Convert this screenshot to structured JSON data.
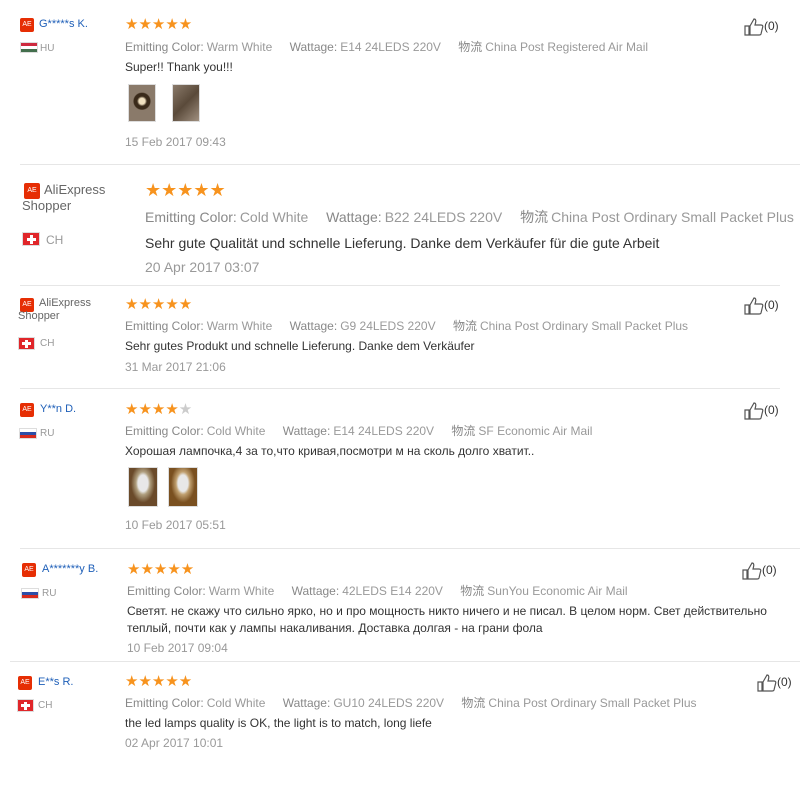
{
  "reviews": [
    {
      "user": "G*****s K.",
      "country": "HU",
      "rating": 5,
      "attrs": [
        {
          "key": "Emitting Color:",
          "val": "Warm White"
        },
        {
          "key": "Wattage:",
          "val": "E14 24LEDS 220V"
        },
        {
          "key": "物流",
          "val": "China Post Registered Air Mail"
        }
      ],
      "text": "Super!! Thank you!!!",
      "date": "15 Feb 2017 09:43",
      "likes": "(0)"
    },
    {
      "user": "AliExpress Shopper",
      "country": "CH",
      "rating": 5,
      "attrs": [
        {
          "key": "Emitting Color:",
          "val": "Cold White"
        },
        {
          "key": "Wattage:",
          "val": "B22 24LEDS 220V"
        },
        {
          "key": "物流",
          "val": "China Post Ordinary Small Packet Plus"
        }
      ],
      "text": "Sehr gute Qualität und schnelle Lieferung. Danke dem Verkäufer für die gute Arbeit",
      "date": "20 Apr 2017 03:07",
      "likes": ""
    },
    {
      "user": "AliExpress Shopper",
      "country": "CH",
      "rating": 5,
      "attrs": [
        {
          "key": "Emitting Color:",
          "val": "Warm White"
        },
        {
          "key": "Wattage:",
          "val": "G9 24LEDS 220V"
        },
        {
          "key": "物流",
          "val": "China Post Ordinary Small Packet Plus"
        }
      ],
      "text": "Sehr gutes Produkt und schnelle Lieferung. Danke dem Verkäufer",
      "date": "31 Mar 2017 21:06",
      "likes": "(0)"
    },
    {
      "user": "Y**n D.",
      "country": "RU",
      "rating": 4,
      "attrs": [
        {
          "key": "Emitting Color:",
          "val": "Cold White"
        },
        {
          "key": "Wattage:",
          "val": "E14 24LEDS 220V"
        },
        {
          "key": "物流",
          "val": "SF Economic Air Mail"
        }
      ],
      "text": "Хорошая лампочка,4 за то,что кривая,посмотри м на сколь долго хватит..",
      "date": "10 Feb 2017 05:51",
      "likes": "(0)"
    },
    {
      "user": "A*******y B.",
      "country": "RU",
      "rating": 5,
      "attrs": [
        {
          "key": "Emitting Color:",
          "val": "Warm White"
        },
        {
          "key": "Wattage:",
          "val": "42LEDS E14 220V"
        },
        {
          "key": "物流",
          "val": "SunYou Economic Air Mail"
        }
      ],
      "text_lines": [
        "Светят. не скажу что сильно ярко, но и про мощность никто ничего и не писал. В целом норм. Свет действительно",
        "теплый, почти как у лампы накаливания. Доставка долгая - на грани фола"
      ],
      "date": "10 Feb 2017 09:04",
      "likes": "(0)"
    },
    {
      "user": "E**s R.",
      "country": "CH",
      "rating": 5,
      "attrs": [
        {
          "key": "Emitting Color:",
          "val": "Cold White"
        },
        {
          "key": "Wattage:",
          "val": "GU10 24LEDS 220V"
        },
        {
          "key": "物流",
          "val": "China Post Ordinary Small Packet Plus"
        }
      ],
      "text": "the led lamps quality is OK, the light is to match, long liefe",
      "date": "02 Apr 2017 10:01",
      "likes": "(0)"
    }
  ]
}
